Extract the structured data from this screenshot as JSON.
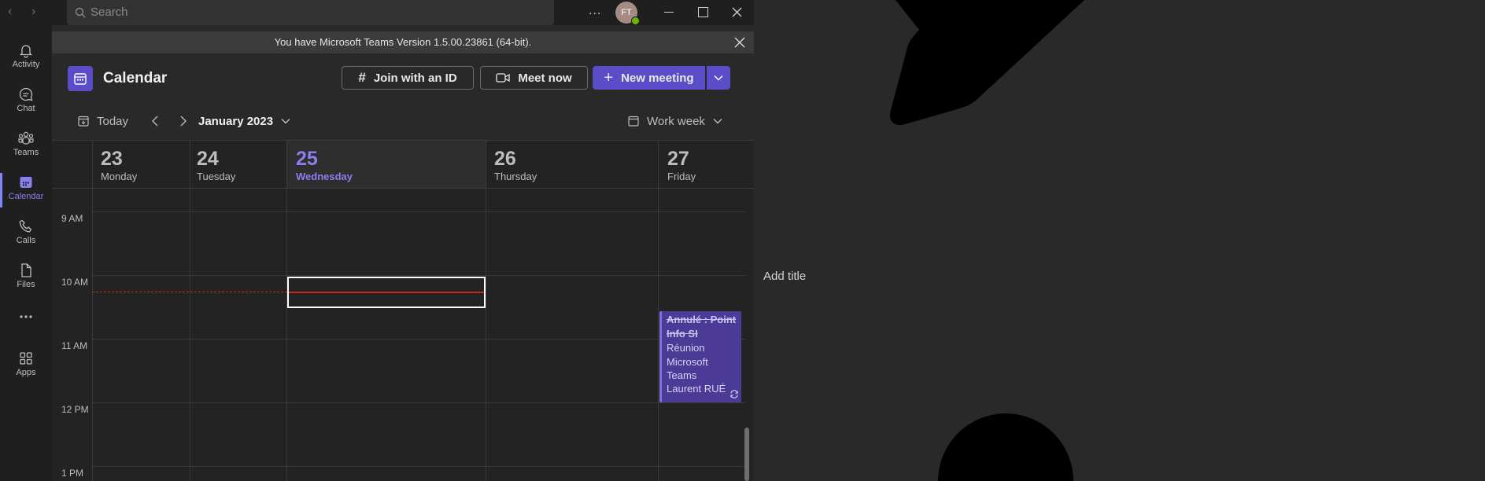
{
  "topbar": {
    "search_placeholder": "Search",
    "avatar_initials": "FT",
    "more_label": "..."
  },
  "rail": {
    "items": [
      {
        "label": "Activity",
        "icon": "bell-icon"
      },
      {
        "label": "Chat",
        "icon": "chat-icon"
      },
      {
        "label": "Teams",
        "icon": "teams-icon"
      },
      {
        "label": "Calendar",
        "icon": "calendar-icon",
        "active": true
      },
      {
        "label": "Calls",
        "icon": "phone-icon"
      },
      {
        "label": "Files",
        "icon": "file-icon"
      },
      {
        "label": "",
        "icon": "more-dots-icon"
      },
      {
        "label": "Apps",
        "icon": "apps-icon"
      }
    ]
  },
  "banner": {
    "text": "You have Microsoft Teams Version 1.5.00.23861 (64-bit)."
  },
  "header": {
    "title": "Calendar",
    "join_label": "Join with an ID",
    "meet_label": "Meet now",
    "new_meeting_label": "New meeting",
    "today_label": "Today",
    "month_label": "January 2023",
    "view_label": "Work week"
  },
  "days": [
    {
      "num": "23",
      "name": "Monday"
    },
    {
      "num": "24",
      "name": "Tuesday"
    },
    {
      "num": "25",
      "name": "Wednesday",
      "today": true
    },
    {
      "num": "26",
      "name": "Thursday"
    },
    {
      "num": "27",
      "name": "Friday"
    }
  ],
  "times": [
    "9 AM",
    "10 AM",
    "11 AM",
    "12 PM",
    "1 PM"
  ],
  "event": {
    "title": "Annulé : Point Info SI",
    "line1": "Réunion",
    "line2": "Microsoft",
    "line3": "Teams",
    "organizer": "Laurent RUÉ"
  },
  "right_panel": {
    "add_title": "Add title"
  },
  "colors": {
    "accent": "#5b4dc8",
    "today": "#8b7ff0",
    "now_line": "#c42b1c",
    "event_bg": "#4b3a96"
  }
}
